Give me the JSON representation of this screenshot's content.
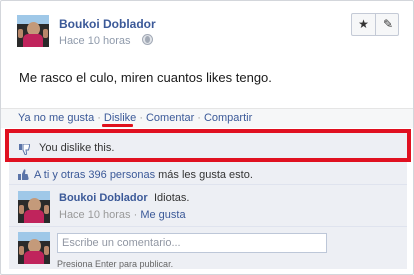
{
  "post": {
    "author": "Boukoi Doblador",
    "time": "Hace 10 horas",
    "status": "Me rasco el culo, miren cuantos likes tengo.",
    "star_glyph": "★",
    "pencil_glyph": "✎"
  },
  "actions": {
    "unlike": "Ya no me gusta",
    "dislike": "Dislike",
    "comment": "Comentar",
    "share": "Compartir",
    "separator": "·",
    "underline_color": "#e0101b"
  },
  "dislike_row": {
    "text": "You dislike this.",
    "highlight_color": "#e01020"
  },
  "likes": {
    "you_others": "A ti y otras 396 personas",
    "rest": " más les gusta esto."
  },
  "comment": {
    "author": "Boukoi Doblador",
    "text": "Idiotas.",
    "time": "Hace 10 horas",
    "separator": "·",
    "like": "Me gusta"
  },
  "compose": {
    "placeholder": "Escribe un comentario...",
    "hint": "Presiona Enter para publicar."
  },
  "colors": {
    "link": "#3b5998",
    "ufi_bg": "#edeff4"
  }
}
